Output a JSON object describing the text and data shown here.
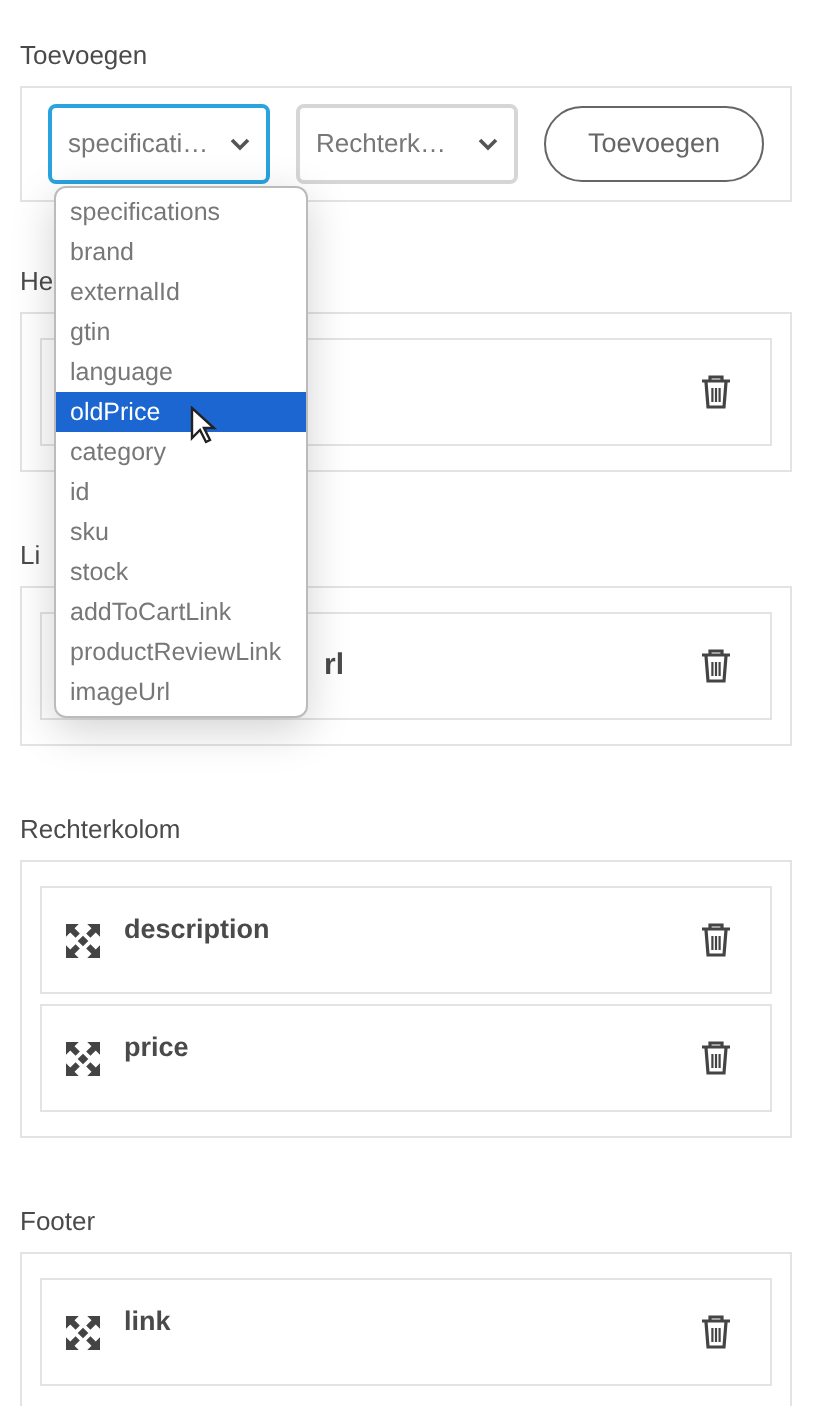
{
  "add_section": {
    "heading": "Toevoegen",
    "field_select": {
      "value": "specificati…",
      "focused": true
    },
    "column_select": {
      "value": "Rechterk…",
      "focused": false
    },
    "button": "Toevoegen"
  },
  "dropdown": {
    "options": [
      {
        "label": "specifications",
        "selected": false
      },
      {
        "label": "brand",
        "selected": false
      },
      {
        "label": "externalId",
        "selected": false
      },
      {
        "label": "gtin",
        "selected": false
      },
      {
        "label": "language",
        "selected": false
      },
      {
        "label": "oldPrice",
        "selected": true
      },
      {
        "label": "category",
        "selected": false
      },
      {
        "label": "id",
        "selected": false
      },
      {
        "label": "sku",
        "selected": false
      },
      {
        "label": "stock",
        "selected": false
      },
      {
        "label": "addToCartLink",
        "selected": false
      },
      {
        "label": "productReviewLink",
        "selected": false
      },
      {
        "label": "imageUrl",
        "selected": false
      }
    ]
  },
  "sections": [
    {
      "heading": "He",
      "items": [
        {
          "handle_visible": false
        }
      ]
    },
    {
      "heading": "Li",
      "items": [
        {
          "handle_visible": false,
          "label": "rl"
        }
      ]
    },
    {
      "heading": "Rechterkolom",
      "items": [
        {
          "handle_visible": true,
          "label": "description"
        },
        {
          "handle_visible": true,
          "label": "price"
        }
      ]
    },
    {
      "heading": "Footer",
      "items": [
        {
          "handle_visible": true,
          "label": "link"
        }
      ]
    }
  ]
}
